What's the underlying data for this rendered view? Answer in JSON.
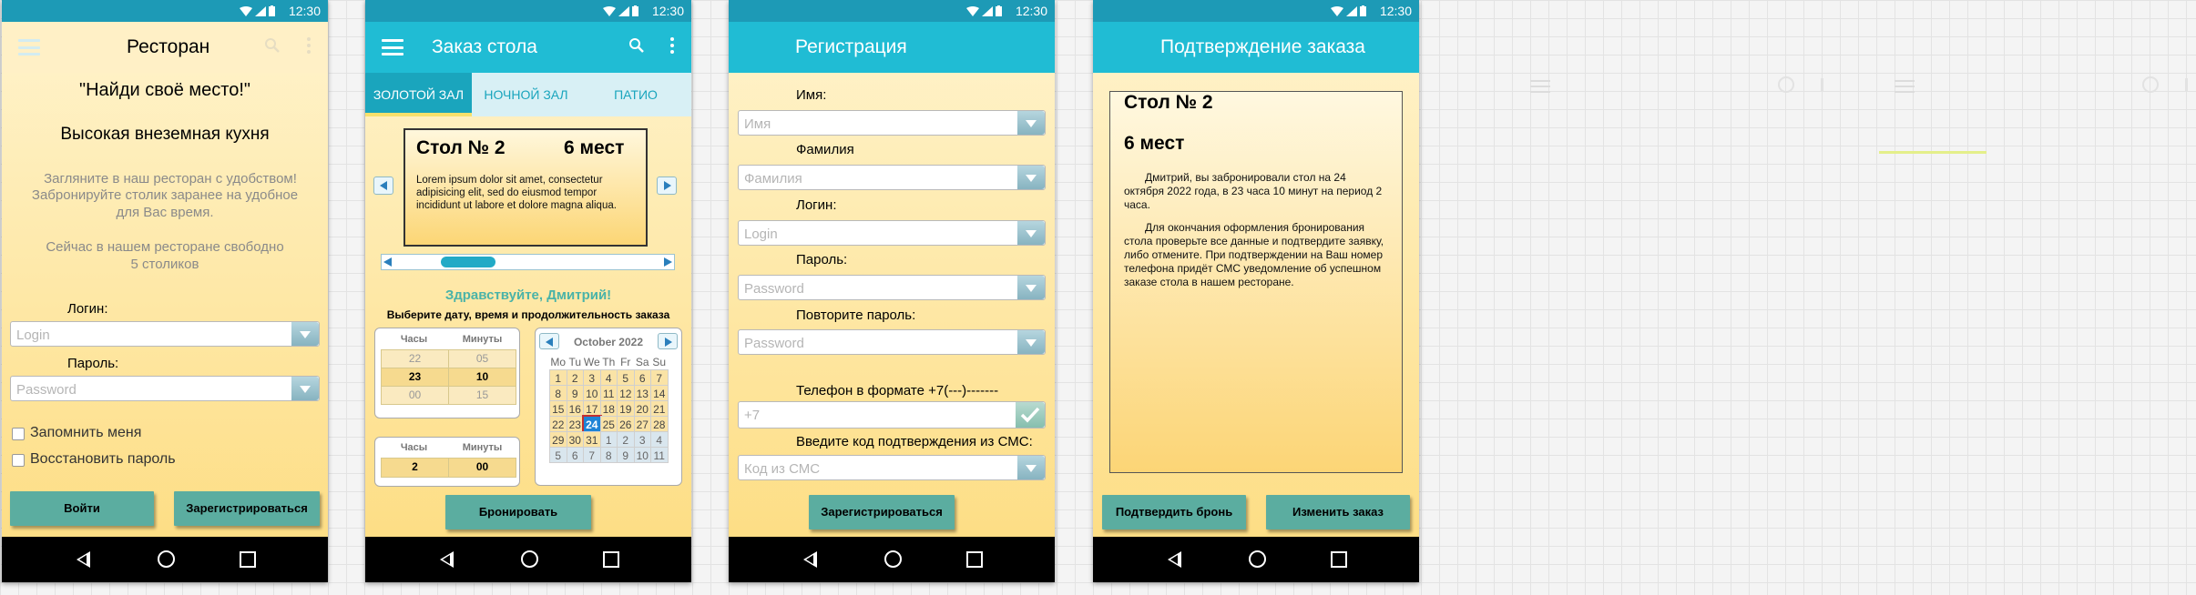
{
  "status": {
    "time": "12:30"
  },
  "nav": {
    "back": "back-icon",
    "home": "home-icon",
    "recent": "recent-icon"
  },
  "screen1": {
    "title": "Ресторан",
    "slogan": "\"Найди своё место!\"",
    "subtitle": "Высокая внеземная кухня",
    "desc_line1": "Загляните в наш ресторан с удобством!",
    "desc_line2": "Забронируйте столик заранее на удобное",
    "desc_line3": "для Вас время.",
    "free_line1": "Сейчас в нашем ресторане свободно",
    "free_line2": "5 столиков",
    "login_label": "Логин:",
    "login_placeholder": "Login",
    "password_label": "Пароль:",
    "password_placeholder": "Password",
    "remember": "Запомнить меня",
    "restore": "Восстановить пароль",
    "login_button": "Войти",
    "register_button": "Зарегистрироваться"
  },
  "screen2": {
    "title": "Заказ стола",
    "tabs": [
      "ЗОЛОТОЙ ЗАЛ",
      "НОЧНОЙ ЗАЛ",
      "ПАТИО"
    ],
    "table_name": "Стол № 2",
    "table_seats": "6 мест",
    "table_desc_line1": "Lorem ipsum dolor sit amet, consectetur",
    "table_desc_line2": "adipisicing elit, sed do eiusmod tempor",
    "table_desc_line3": "incididunt ut labore et dolore magna aliqua.",
    "greeting": "Здравствуйте, Дмитрий!",
    "instruction": "Выберите дату, время и продолжительность заказа",
    "time_headers": [
      "Часы",
      "Минуты"
    ],
    "time_rows": [
      [
        "22",
        "05"
      ],
      [
        "23",
        "10"
      ],
      [
        "00",
        "15"
      ]
    ],
    "duration_headers": [
      "Часы",
      "Минуты"
    ],
    "duration_values": [
      "2",
      "00"
    ],
    "calendar_month": "October 2022",
    "calendar_days": [
      "Mo",
      "Tu",
      "We",
      "Th",
      "Fr",
      "Sa",
      "Su"
    ],
    "calendar_cells": [
      [
        "1",
        "2",
        "3",
        "4",
        "5",
        "6",
        "7"
      ],
      [
        "8",
        "9",
        "10",
        "11",
        "12",
        "13",
        "14"
      ],
      [
        "15",
        "16",
        "17",
        "18",
        "19",
        "20",
        "21"
      ],
      [
        "22",
        "23",
        "24",
        "25",
        "26",
        "27",
        "28"
      ],
      [
        "29",
        "30",
        "31",
        "1",
        "2",
        "3",
        "4"
      ],
      [
        "5",
        "6",
        "7",
        "8",
        "9",
        "10",
        "11"
      ]
    ],
    "selected_day": "24",
    "book_button": "Бронировать"
  },
  "screen3": {
    "title": "Регистрация",
    "name_label": "Имя:",
    "name_placeholder": "Имя",
    "surname_label": "Фамилия",
    "surname_placeholder": "Фамилия",
    "login_label": "Логин:",
    "login_placeholder": "Login",
    "password_label": "Пароль:",
    "password_placeholder": "Password",
    "repeat_label": "Повторите пароль:",
    "repeat_placeholder": "Password",
    "phone_label": "Телефон в формате +7(---)-------",
    "phone_placeholder": "+7",
    "sms_label": "Введите код подтверждения из СМС:",
    "sms_placeholder": "Код из СМС",
    "register_button": "Зарегистрироваться"
  },
  "screen4": {
    "title": "Подтверждение заказа",
    "table_name": "Стол № 2",
    "table_seats": "6 мест",
    "para1_line1": "Дмитрий, вы забронировали стол на 24",
    "para1_line2": "октября 2022 года, в 23 часа 10 минут на период 2",
    "para1_line3": "часа.",
    "para2_line1": "Для окончания оформления бронирования",
    "para2_line2": "стола проверьте все данные и подтвердите заявку,",
    "para2_line3": "либо отмените. При подтверждении на Ваш номер",
    "para2_line4": "телефона придёт СМС уведомление об успешном",
    "para2_line5": "заказе стола в нашем ресторане.",
    "confirm_button": "Подтвердить бронь",
    "change_button": "Изменить заказ"
  },
  "colors": {
    "statusbar": "#1d9ab6",
    "appbar": "#20bcd4",
    "button": "#5bada0",
    "background_top": "#fff4cf",
    "background_bottom": "#fddc7f"
  }
}
